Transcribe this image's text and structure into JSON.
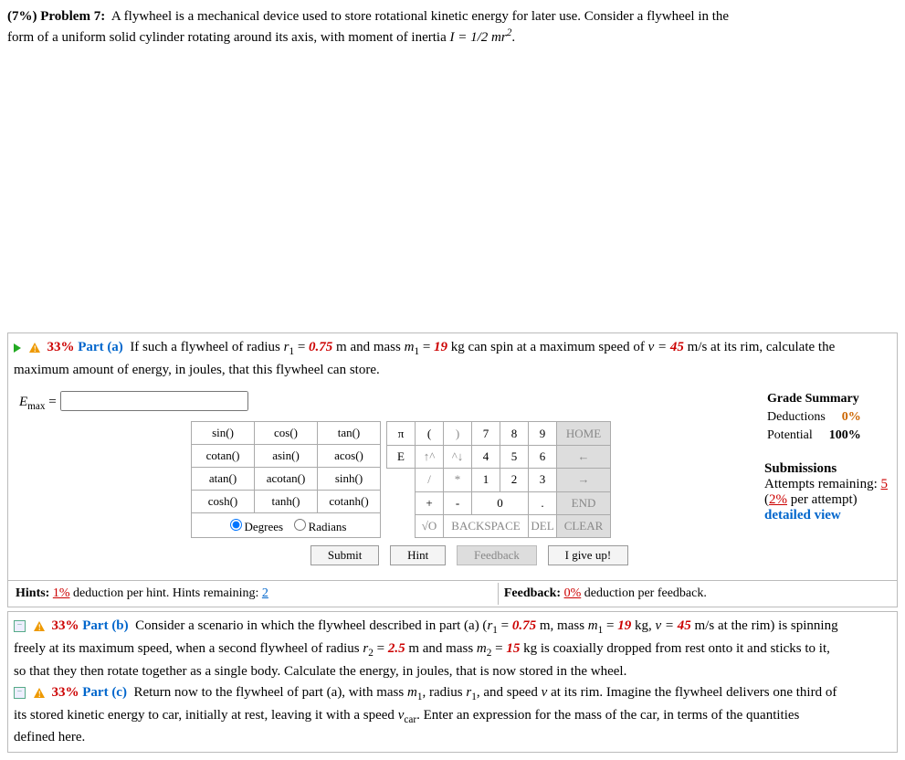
{
  "problem": {
    "percent": "(7%)",
    "label": "Problem 7:",
    "text1": "A flywheel is a mechanical device used to store rotational kinetic energy for later use. Consider a flywheel in the",
    "text2": "form of a uniform solid cylinder rotating around its axis, with moment of inertia ",
    "inertia": "I = 1/2 mr",
    "exp": "2",
    "dot": "."
  },
  "partA": {
    "pct": "33%",
    "label": "Part (a)",
    "t1": "If such a flywheel of radius ",
    "r1": "r",
    "r1sub": "1",
    "eq1": " = ",
    "v1": "0.75",
    "t2": " m and mass ",
    "m1": "m",
    "m1sub": "1",
    "eq2": " = ",
    "v2": "19",
    "t3": " kg can spin at a maximum speed of ",
    "vlbl": "v = ",
    "v3": "45",
    "t4": " m/s at its rim, calculate the",
    "t5": "maximum amount of energy, in joules, that this flywheel can store."
  },
  "answer": {
    "lhs_e": "E",
    "lhs_sub": "max",
    "eq": " = "
  },
  "funcs": {
    "r1": [
      "sin()",
      "cos()",
      "tan()"
    ],
    "r2": [
      "cotan()",
      "asin()",
      "acos()"
    ],
    "r3": [
      "atan()",
      "acotan()",
      "sinh()"
    ],
    "r4": [
      "cosh()",
      "tanh()",
      "cotanh()"
    ],
    "deg": "Degrees",
    "rad": "Radians"
  },
  "nums": {
    "pi": "π",
    "lp": "(",
    "rp": ")",
    "n7": "7",
    "n8": "8",
    "n9": "9",
    "home": "HOME",
    "E": "E",
    "up": "↑^",
    "upr": "^↓",
    "n4": "4",
    "n5": "5",
    "n6": "6",
    "left": "←",
    "sl": "/",
    "ast": "*",
    "n1": "1",
    "n2": "2",
    "n3": "3",
    "right": "→",
    "plus": "+",
    "minus": "-",
    "n0": "0",
    "dot": ".",
    "end": "END",
    "sqrt": "√O",
    "bksp": "BACKSPACE",
    "del": "DEL",
    "clr": "CLEAR"
  },
  "btns": {
    "submit": "Submit",
    "hint": "Hint",
    "fb": "Feedback",
    "give": "I give up!"
  },
  "summary": {
    "hd": "Grade Summary",
    "ded": "Deductions",
    "dedv": "0%",
    "pot": "Potential",
    "potv": "100%",
    "sub": "Submissions",
    "att1": "Attempts remaining: ",
    "attv": "5",
    "att2": "(",
    "att2b": "2%",
    "att3": " per attempt)",
    "dv": "detailed view"
  },
  "foot": {
    "h1": "Hints: ",
    "h1v": "1%",
    "h2": " deduction per hint. Hints remaining: ",
    "h2v": "2",
    "f1": "Feedback: ",
    "f1v": "0%",
    "f2": " deduction per feedback."
  },
  "partB": {
    "pct": "33%",
    "label": "Part (b)",
    "t1": "Consider a scenario in which the flywheel described in part (a) (",
    "r": "r",
    "rsub": "1",
    "eq": " = ",
    "rv": "0.75",
    "t2": " m, mass ",
    "m": "m",
    "msub": "1",
    "meq": " = ",
    "mv": "19",
    "t3": " kg, ",
    "v": "v = ",
    "vv": "45",
    "t4": " m/s at the rim) is spinning",
    "t5": "freely at its maximum speed, when a second flywheel of radius ",
    "r2": "r",
    "r2sub": "2",
    "r2eq": " = ",
    "r2v": "2.5",
    "t6": " m and mass ",
    "m2": "m",
    "m2sub": "2",
    "m2eq": " = ",
    "m2v": "15",
    "t7": " kg is coaxially dropped from rest onto it and sticks to it,",
    "t8": "so that they then rotate together as a single body. Calculate the energy, in joules, that is now stored in the wheel."
  },
  "partC": {
    "pct": "33%",
    "label": "Part (c)",
    "t1": "Return now to the flywheel of part (a), with mass ",
    "m": "m",
    "msub": "1",
    "t2": ", radius ",
    "r": "r",
    "rsub": "1",
    "t3": ", and speed ",
    "v": "v",
    "t4": " at its rim. Imagine the flywheel delivers one third of",
    "t5": "its stored kinetic energy to car, initially at rest, leaving it with a speed ",
    "vc": "v",
    "vcsub": "car",
    "t6": ". Enter an expression for the mass of the car, in terms of the quantities",
    "t7": "defined here."
  }
}
